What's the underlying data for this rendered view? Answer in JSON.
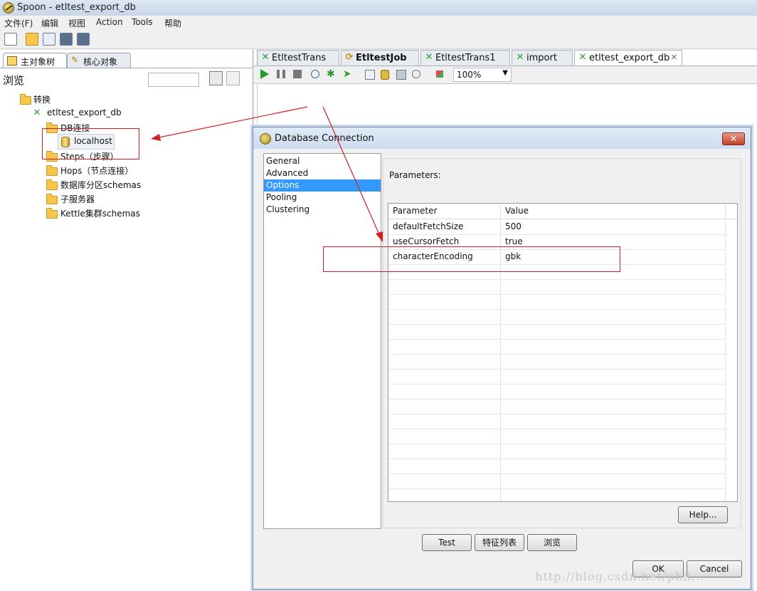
{
  "window": {
    "title": "Spoon - etltest_export_db"
  },
  "menu": [
    "文件(F)",
    "编辑",
    "视图",
    "Action",
    "Tools",
    "帮助"
  ],
  "left_panel": {
    "tabs": [
      "主对象树",
      "核心对象"
    ],
    "browse_label": "浏览",
    "tree": {
      "root": "转换",
      "trans": "etltest_export_db",
      "db_conn": "DB连接",
      "db_item": "localhost",
      "steps": "Steps（步骤）",
      "hops": "Hops（节点连接）",
      "schemas": "数据库分区schemas",
      "slave": "子服务器",
      "cluster": "Kettle集群schemas"
    }
  },
  "editor": {
    "tabs": [
      "EtltestTrans",
      "EtltestJob",
      "EtltestTrans1",
      "import",
      "etltest_export_db"
    ],
    "zoom": "100%"
  },
  "dialog": {
    "title": "Database Connection",
    "nav": [
      "General",
      "Advanced",
      "Options",
      "Pooling",
      "Clustering"
    ],
    "params_label": "Parameters:",
    "columns": [
      "Parameter",
      "Value"
    ],
    "rows": [
      {
        "param": "defaultFetchSize",
        "value": "500"
      },
      {
        "param": "useCursorFetch",
        "value": "true"
      },
      {
        "param": "characterEncoding",
        "value": "gbk"
      }
    ],
    "help": "Help...",
    "test": "Test",
    "features": "特征列表",
    "explore": "浏览",
    "ok": "OK",
    "cancel": "Cancel"
  },
  "watermark": "http://blog.csdn.net/phil..."
}
